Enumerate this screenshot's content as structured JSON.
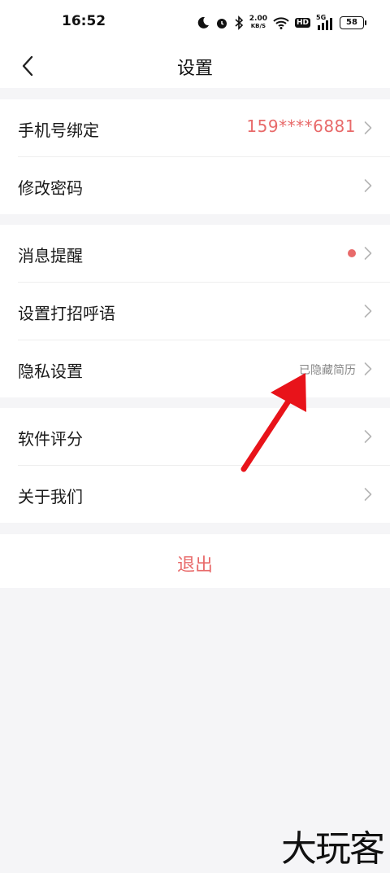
{
  "status_bar": {
    "time": "16:52",
    "network_speed_value": "2.00",
    "network_speed_unit": "KB/S",
    "hd_label": "HD",
    "signal_label": "5G",
    "battery": "58"
  },
  "nav": {
    "title": "设置"
  },
  "groups": [
    {
      "rows": [
        {
          "label": "手机号绑定",
          "value": "159****6881"
        },
        {
          "label": "修改密码"
        }
      ]
    },
    {
      "rows": [
        {
          "label": "消息提醒",
          "has_red_dot": true
        },
        {
          "label": "设置打招呼语"
        },
        {
          "label": "隐私设置",
          "hint": "已隐藏简历"
        }
      ]
    },
    {
      "rows": [
        {
          "label": "软件评分"
        },
        {
          "label": "关于我们"
        }
      ]
    }
  ],
  "logout_label": "退出",
  "watermark": "大玩客",
  "colors": {
    "accent": "#e86a6a",
    "background": "#f5f5f7",
    "annotation_arrow": "#e8131a"
  }
}
